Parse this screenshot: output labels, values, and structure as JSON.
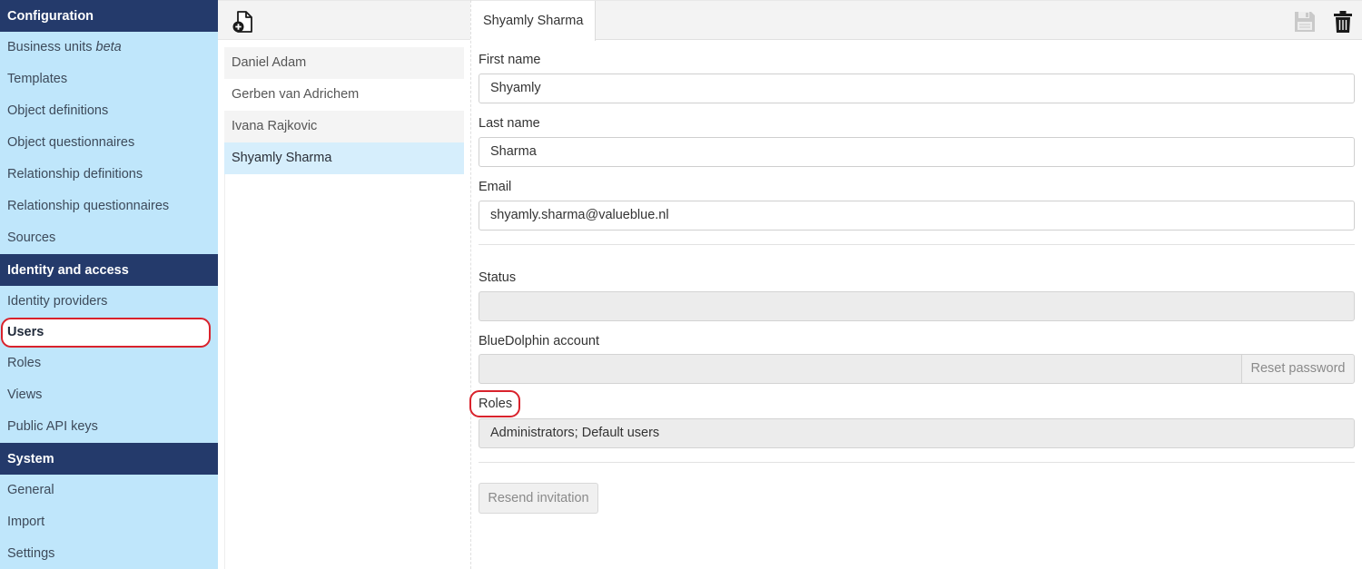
{
  "sidebar": {
    "sections": [
      {
        "title": "Configuration"
      },
      {
        "title": "Identity and access"
      },
      {
        "title": "System"
      }
    ],
    "configuration_items": [
      {
        "label": "Business units",
        "suffix": "beta"
      },
      {
        "label": "Templates"
      },
      {
        "label": "Object definitions"
      },
      {
        "label": "Object questionnaires"
      },
      {
        "label": "Relationship definitions"
      },
      {
        "label": "Relationship questionnaires"
      },
      {
        "label": "Sources"
      }
    ],
    "identity_items": [
      {
        "label": "Identity providers"
      },
      {
        "label": "Users"
      },
      {
        "label": "Roles"
      },
      {
        "label": "Views"
      },
      {
        "label": "Public API keys"
      }
    ],
    "system_items": [
      {
        "label": "General"
      },
      {
        "label": "Import"
      },
      {
        "label": "Settings"
      }
    ]
  },
  "users": [
    "Daniel Adam",
    "Gerben van Adrichem",
    "Ivana Rajkovic",
    "Shyamly Sharma"
  ],
  "detail": {
    "tab_title": "Shyamly Sharma",
    "first_name_label": "First name",
    "first_name": "Shyamly",
    "last_name_label": "Last name",
    "last_name": "Sharma",
    "email_label": "Email",
    "email": "shyamly.sharma@valueblue.nl",
    "status_label": "Status",
    "status": "",
    "account_label": "BlueDolphin account",
    "account": "",
    "reset_password_label": "Reset password",
    "roles_label": "Roles",
    "roles": "Administrators; Default users",
    "resend_invitation_label": "Resend invitation"
  },
  "icons": {
    "new": "new-document-icon",
    "save": "save-icon",
    "delete": "trash-icon"
  },
  "colors": {
    "sidebar_bg": "#bfe6fb",
    "section_header": "#243a6b",
    "highlight": "#d9222c",
    "selected_row": "#d6eefc"
  }
}
